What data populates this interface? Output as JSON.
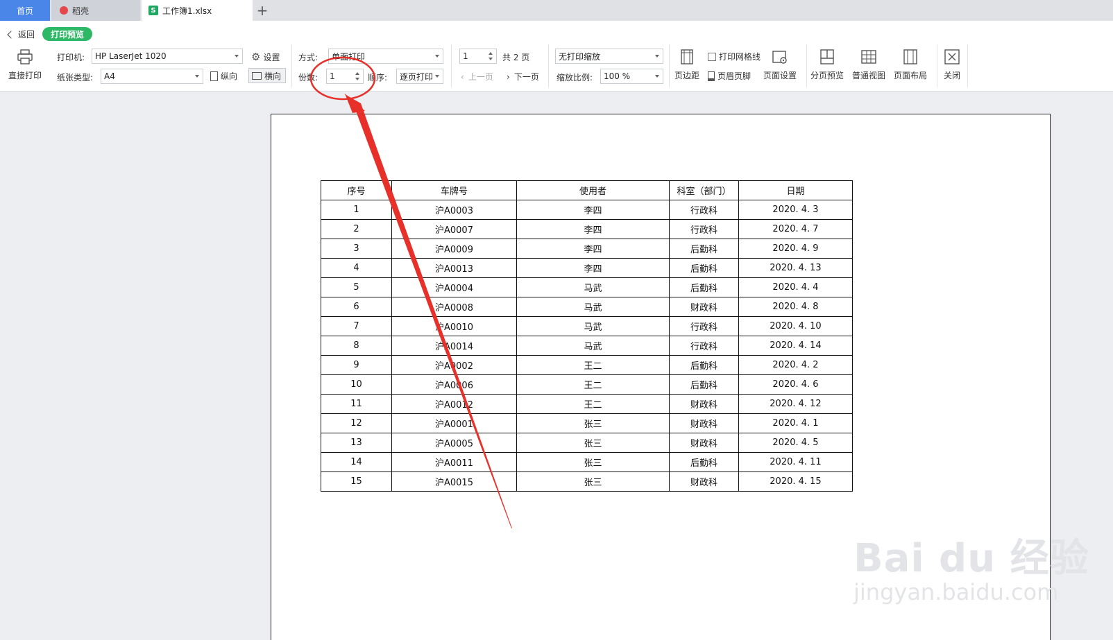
{
  "tabs": [
    {
      "label": "首页"
    },
    {
      "label": "稻壳"
    },
    {
      "label": "工作簿1.xlsx"
    }
  ],
  "nav": {
    "back": "返回",
    "mode": "打印预览"
  },
  "toolbar": {
    "direct_print": "直接打印",
    "printer_label": "打印机:",
    "printer_value": "HP LaserJet 1020",
    "settings": "设置",
    "paper_label": "纸张类型:",
    "paper_value": "A4",
    "portrait": "纵向",
    "landscape": "横向",
    "method_label": "方式:",
    "method_value": "单面打印",
    "copies_label": "份数:",
    "copies_value": "1",
    "order_label": "顺序:",
    "order_value": "逐页打印",
    "page_value": "1",
    "total_pages": "共 2 页",
    "prev_page": "上一页",
    "next_page": "下一页",
    "scaling_value": "无打印缩放",
    "zoom_label": "缩放比例:",
    "zoom_value": "100 %",
    "margins": "页边距",
    "print_gridlines": "打印网格线",
    "header_footer": "页眉页脚",
    "page_setup": "页面设置",
    "page_break_preview": "分页预览",
    "normal_view": "普通视图",
    "page_layout": "页面布局",
    "close": "关闭"
  },
  "table": {
    "headers": [
      "序号",
      "车牌号",
      "使用者",
      "科室（部门）",
      "日期"
    ],
    "rows": [
      [
        "1",
        "沪A0003",
        "李四",
        "行政科",
        "2020. 4. 3"
      ],
      [
        "2",
        "沪A0007",
        "李四",
        "行政科",
        "2020. 4. 7"
      ],
      [
        "3",
        "沪A0009",
        "李四",
        "后勤科",
        "2020. 4. 9"
      ],
      [
        "4",
        "沪A0013",
        "李四",
        "后勤科",
        "2020. 4. 13"
      ],
      [
        "5",
        "沪A0004",
        "马武",
        "后勤科",
        "2020. 4. 4"
      ],
      [
        "6",
        "沪A0008",
        "马武",
        "财政科",
        "2020. 4. 8"
      ],
      [
        "7",
        "沪A0010",
        "马武",
        "行政科",
        "2020. 4. 10"
      ],
      [
        "8",
        "沪A0014",
        "马武",
        "行政科",
        "2020. 4. 14"
      ],
      [
        "9",
        "沪A0002",
        "王二",
        "后勤科",
        "2020. 4. 2"
      ],
      [
        "10",
        "沪A0006",
        "王二",
        "后勤科",
        "2020. 4. 6"
      ],
      [
        "11",
        "沪A0012",
        "王二",
        "财政科",
        "2020. 4. 12"
      ],
      [
        "12",
        "沪A0001",
        "张三",
        "财政科",
        "2020. 4. 1"
      ],
      [
        "13",
        "沪A0005",
        "张三",
        "财政科",
        "2020. 4. 5"
      ],
      [
        "14",
        "沪A0011",
        "张三",
        "后勤科",
        "2020. 4. 11"
      ],
      [
        "15",
        "沪A0015",
        "张三",
        "财政科",
        "2020. 4. 15"
      ]
    ]
  },
  "watermark": {
    "main": "Bai du 经验",
    "url": "jingyan.baidu.com"
  },
  "colors": {
    "home_tab": "#4a86e8",
    "preview_pill": "#2db865",
    "annotation": "#e8302a"
  }
}
